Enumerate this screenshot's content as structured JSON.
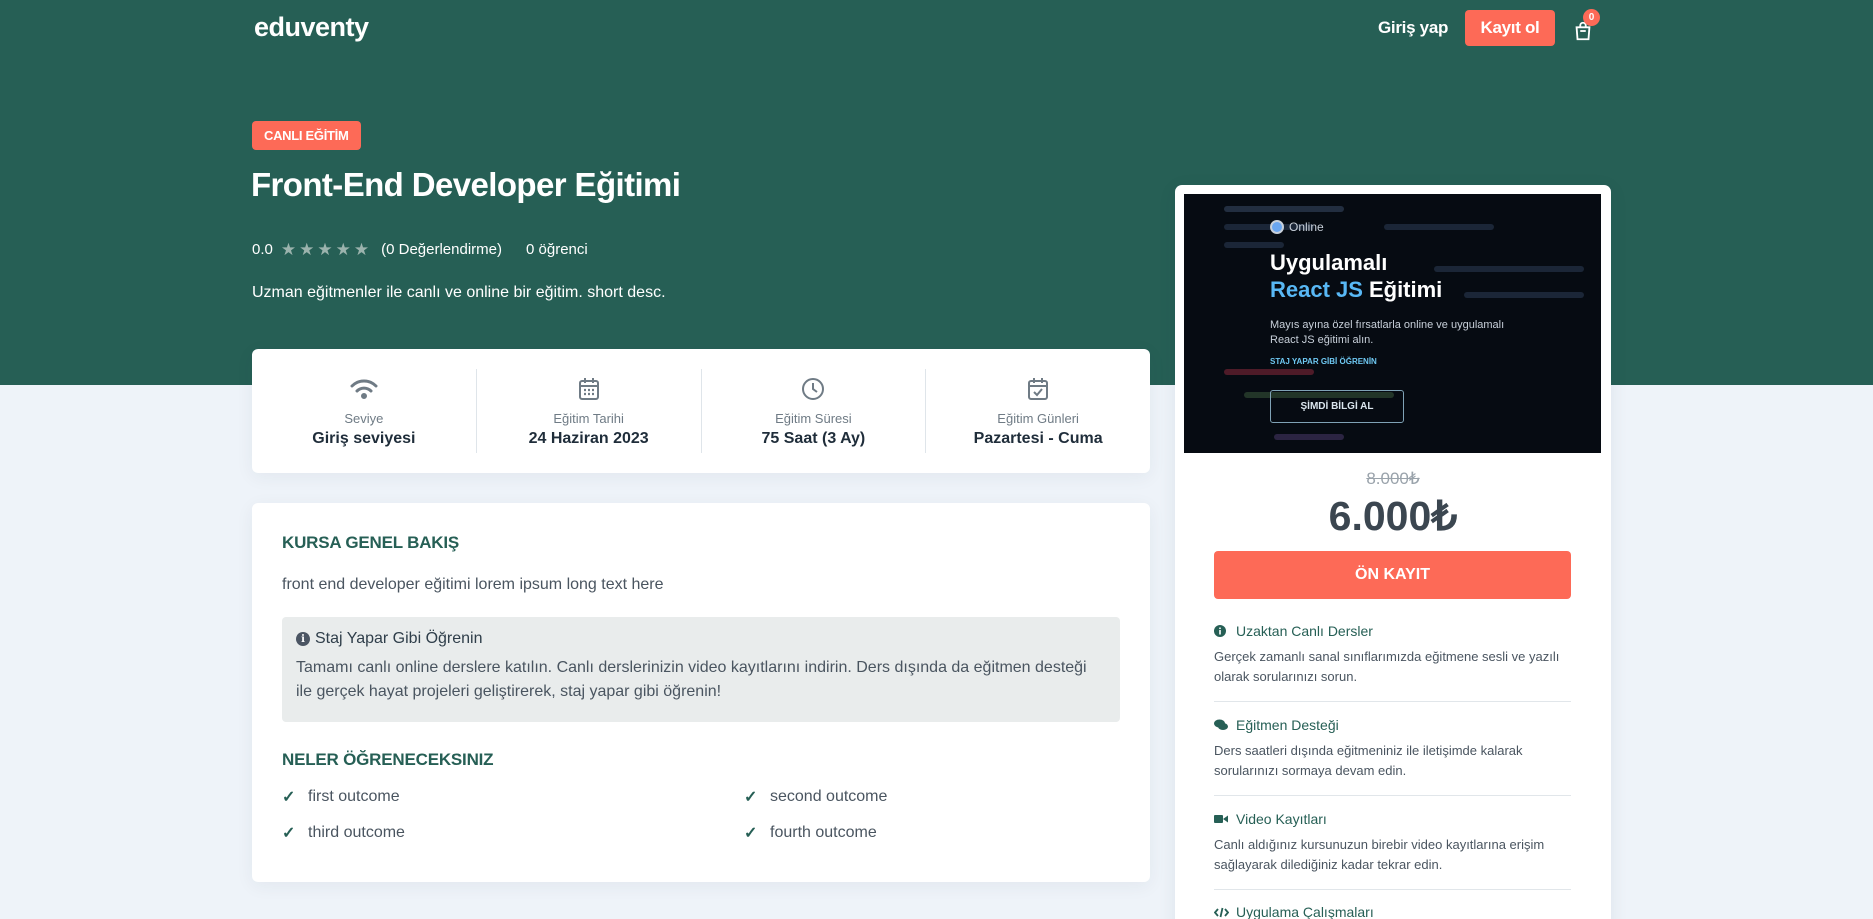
{
  "header": {
    "logo": "eduventy",
    "login": "Giriş yap",
    "register": "Kayıt ol",
    "cart_count": "0"
  },
  "hero": {
    "badge": "CANLI EĞİTİM",
    "title": "Front-End Developer Eğitimi",
    "rating": "0.0",
    "stars_filled": 0,
    "stars_total": 5,
    "reviews": "(0 Değerlendirme)",
    "students": "0 öğrenci",
    "short_desc": "Uzman eğitmenler ile canlı ve online bir eğitim. short desc."
  },
  "info": [
    {
      "icon": "wifi-icon",
      "label": "Seviye",
      "value": "Giriş seviyesi"
    },
    {
      "icon": "calendar-icon",
      "label": "Eğitim Tarihi",
      "value": "24 Haziran 2023"
    },
    {
      "icon": "clock-icon",
      "label": "Eğitim Süresi",
      "value": "75 Saat (3 Ay)"
    },
    {
      "icon": "calendar-check-icon",
      "label": "Eğitim Günleri",
      "value": "Pazartesi - Cuma"
    }
  ],
  "overview": {
    "heading": "KURSA GENEL BAKIŞ",
    "text": "front end developer eğitimi  lorem ipsum long text here",
    "note_title": "Staj Yapar Gibi Öğrenin",
    "note_text": "Tamamı canlı online derslere katılın. Canlı derslerinizin video kayıtlarını indirin. Ders dışında da eğitmen desteği ile gerçek hayat projeleri geliştirerek, staj yapar gibi öğrenin!",
    "learn_heading": "NELER ÖĞRENECEKSINIZ",
    "outcomes": [
      "first outcome",
      "second outcome",
      "third outcome",
      "fourth outcome"
    ]
  },
  "sidebar": {
    "promo": {
      "online": "Online",
      "title_line1": "Uygulamalı",
      "title_accent": "React JS",
      "title_rest": "Eğitimi",
      "desc": "Mayıs ayına özel fırsatlarla online ve uygulamalı React JS eğitimi alın.",
      "small": "STAJ YAPAR GİBİ ÖĞRENİN",
      "button": "ŞİMDİ BİLGİ AL"
    },
    "old_price": "8.000₺",
    "price": "6.000₺",
    "enroll": "ÖN KAYIT",
    "features": [
      {
        "icon": "info-icon",
        "title": "Uzaktan Canlı Dersler",
        "desc": "Gerçek zamanlı sanal sınıflarımızda eğitmene sesli ve yazılı olarak sorularınızı sorun."
      },
      {
        "icon": "chat-icon",
        "title": "Eğitmen Desteği",
        "desc": "Ders saatleri dışında eğitmeniniz ile iletişimde kalarak sorularınızı sormaya devam edin."
      },
      {
        "icon": "video-icon",
        "title": "Video Kayıtları",
        "desc": "Canlı aldığınız kursunuzun birebir video kayıtlarına erişim sağlayarak dilediğiniz kadar tekrar edin."
      },
      {
        "icon": "code-icon",
        "title": "Uygulama Çalışmaları",
        "desc": ""
      }
    ]
  }
}
